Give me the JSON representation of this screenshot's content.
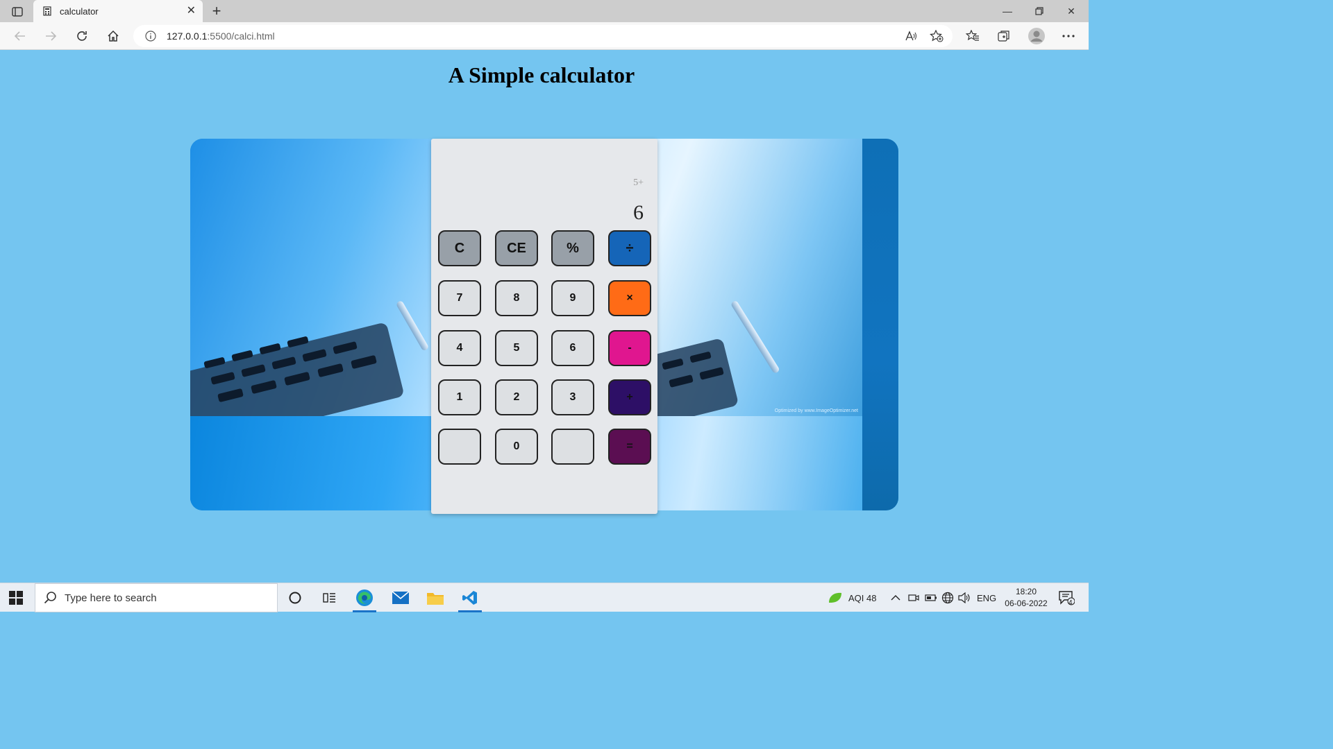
{
  "browser": {
    "tab_title": "calculator",
    "url_host": "127.0.0.1",
    "url_path": ":5500/calci.html"
  },
  "page": {
    "title": "A Simple calculator"
  },
  "calculator": {
    "expression": "5+",
    "result": "6",
    "keys": {
      "clear": "C",
      "clear_entry": "CE",
      "percent": "%",
      "divide": "÷",
      "seven": "7",
      "eight": "8",
      "nine": "9",
      "multiply": "×",
      "four": "4",
      "five": "5",
      "six": "6",
      "subtract": "-",
      "one": "1",
      "two": "2",
      "three": "3",
      "add": "+",
      "blank_left": "",
      "zero": "0",
      "blank_right": "",
      "equals": "="
    },
    "colors": {
      "function_key": "#98a0a8",
      "divide": "#1565b8",
      "multiply": "#ff6b16",
      "subtract": "#e0168f",
      "add": "#2d0f66",
      "equals": "#5b0e52"
    }
  },
  "hero": {
    "watermark": "Optimized by www.ImageOptimizer.net"
  },
  "taskbar": {
    "search_placeholder": "Type here to search",
    "weather": "AQI 48",
    "language": "ENG",
    "time": "18:20",
    "date": "06-06-2022",
    "notification_count": "4"
  }
}
